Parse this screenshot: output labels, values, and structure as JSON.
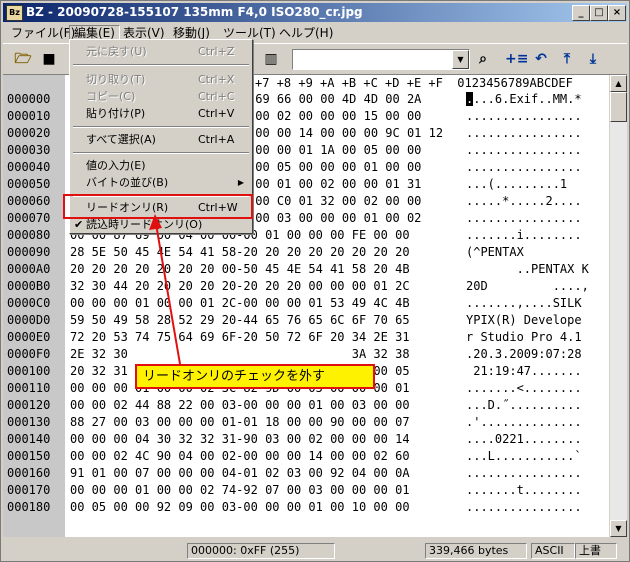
{
  "window": {
    "title": "BZ - 20090728-155107 135mm F4,0 ISO280_cr.jpg",
    "app_icon": "Bz"
  },
  "menubar": {
    "items": [
      "ファイル(F)",
      "編集(E)",
      "表示(V)",
      "移動(J)",
      "ツール(T)",
      "ヘルプ(H)"
    ]
  },
  "edit_menu": {
    "items": [
      {
        "label": "元に戻す(U)",
        "shortcut": "Ctrl+Z"
      },
      {
        "label": "切り取り(T)",
        "shortcut": "Ctrl+X"
      },
      {
        "label": "コピー(C)",
        "shortcut": "Ctrl+C"
      },
      {
        "label": "貼り付け(P)",
        "shortcut": "Ctrl+V"
      },
      {
        "label": "すべて選択(A)",
        "shortcut": "Ctrl+A"
      },
      {
        "label": "値の入力(E)",
        "shortcut": ""
      },
      {
        "label": "バイトの並び(B)",
        "shortcut": ""
      },
      {
        "label": "リードオンリ(R)",
        "shortcut": "Ctrl+W"
      },
      {
        "label": "読込時リードオンリ(O)",
        "shortcut": ""
      }
    ]
  },
  "editor": {
    "header_cols": "+7 +8 +9 +A +B +C +D +E +F  0123456789ABCDEF",
    "rows": [
      {
        "addr": "000000",
        "hex": "-69 66 00 00 4D 4D 00 2A",
        "asc_cursor": ".",
        "asc": "...6.Exif..MM.*"
      },
      {
        "addr": "000010",
        "hex": "-00 02 00 00 00 15 00 00",
        "asc_cursor": "",
        "asc": "................"
      },
      {
        "addr": "000020",
        "hex": "-00 00 14 00 00 00 9C 01 12",
        "asc_cursor": "",
        "asc": "................"
      },
      {
        "addr": "000030",
        "hex": "-00 00 01 1A 00 05 00 00",
        "asc_cursor": "",
        "asc": "................"
      },
      {
        "addr": "000040",
        "hex": "-00 05 00 00 00 01 00 00",
        "asc_cursor": "",
        "asc": "................"
      },
      {
        "addr": "000050",
        "hex": "-00 01 00 02 00 00 01 31",
        "asc_cursor": "",
        "asc": "...(.........1"
      },
      {
        "addr": "000060",
        "hex": "-00 C0 01 32 00 02 00 00",
        "asc_cursor": "",
        "asc": ".....*.....2...."
      },
      {
        "addr": "000070",
        "hex": "-00 03 00 00 00 01 00 02",
        "asc_cursor": "",
        "asc": "................"
      },
      {
        "addr": "000080",
        "hex": "00 00 87 69 00 04 00 00-00 01 00 00 00 FE 00 00",
        "asc_cursor": "",
        "asc": ".......i........"
      },
      {
        "addr": "000090",
        "hex": "28 5E 50 45 4E 54 41 58-20 20 20 20 20 20 20 20",
        "asc_cursor": "",
        "asc": "(^PENTAX"
      },
      {
        "addr": "0000A0",
        "hex": "20 20 20 20 20 20 20 00-50 45 4E 54 41 58 20 4B",
        "asc_cursor": "",
        "asc": "       ..PENTAX K"
      },
      {
        "addr": "0000B0",
        "hex": "32 30 44 20 20 20 20 20-20 20 20 00 00 00 01 2C",
        "asc_cursor": "",
        "asc": "20D         ....,"
      },
      {
        "addr": "0000C0",
        "hex": "00 00 00 01 00 00 01 2C-00 00 00 01 53 49 4C 4B",
        "asc_cursor": "",
        "asc": ".......,....SILK"
      },
      {
        "addr": "0000D0",
        "hex": "59 50 49 58 28 52 29 20-44 65 76 65 6C 6F 70 65",
        "asc_cursor": "",
        "asc": "YPIX(R) Develope"
      },
      {
        "addr": "0000E0",
        "hex": "72 20 53 74 75 64 69 6F-20 50 72 6F 20 34 2E 31",
        "asc_cursor": "",
        "asc": "r Studio Pro 4.1"
      },
      {
        "addr": "0000F0",
        "hex": "2E 32 30                               3A 32 38",
        "asc_cursor": "",
        "asc": ".20.3.2009:07:28"
      },
      {
        "addr": "000100",
        "hex": "20 32 31                               9A 00 05",
        "asc_cursor": "",
        "asc": " 21:19:47......."
      },
      {
        "addr": "000110",
        "hex": "00 00 00 01 00 00 02 3C-82 9D 00 05 00 00 00 01",
        "asc_cursor": "",
        "asc": ".......<........"
      },
      {
        "addr": "000120",
        "hex": "00 00 02 44 88 22 00 03-00 00 00 01 00 03 00 00",
        "asc_cursor": "",
        "asc": "...D.˝.........."
      },
      {
        "addr": "000130",
        "hex": "88 27 00 03 00 00 00 01-01 18 00 00 90 00 00 07",
        "asc_cursor": "",
        "asc": ".'.............."
      },
      {
        "addr": "000140",
        "hex": "00 00 00 04 30 32 32 31-90 03 00 02 00 00 00 14",
        "asc_cursor": "",
        "asc": "....0221........"
      },
      {
        "addr": "000150",
        "hex": "00 00 02 4C 90 04 00 02-00 00 00 14 00 00 02 60",
        "asc_cursor": "",
        "asc": "...L...........`"
      },
      {
        "addr": "000160",
        "hex": "91 01 00 07 00 00 00 04-01 02 03 00 92 04 00 0A",
        "asc_cursor": "",
        "asc": "................"
      },
      {
        "addr": "000170",
        "hex": "00 00 00 01 00 00 02 74-92 07 00 03 00 00 00 01",
        "asc_cursor": "",
        "asc": ".......t........"
      },
      {
        "addr": "000180",
        "hex": "00 05 00 00 92 09 00 03-00 00 00 01 00 10 00 00",
        "asc_cursor": "",
        "asc": "................"
      }
    ]
  },
  "statusbar": {
    "position": "000000: 0xFF (255)",
    "size": "339,466 bytes",
    "charset": "ASCII",
    "mode": "上書"
  },
  "annotation": {
    "callout_text": "リードオンリのチェックを外す",
    "color": "#e01010",
    "fill": "#fff200"
  }
}
